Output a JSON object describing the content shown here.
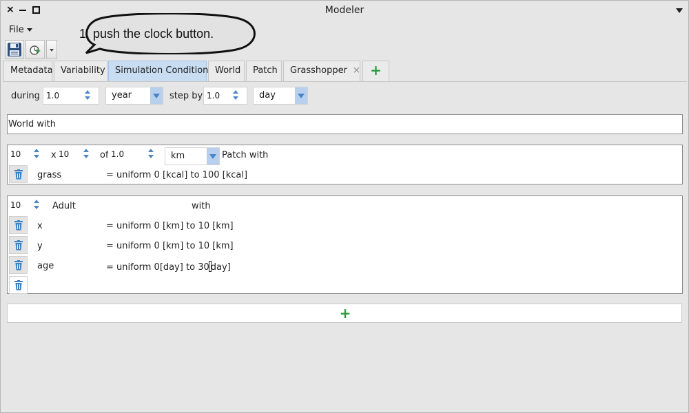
{
  "window": {
    "title": "Modeler",
    "close": "×"
  },
  "menu": {
    "file": "File"
  },
  "callout": {
    "text": "1. push the clock button."
  },
  "tabs": [
    {
      "label": "Metadata"
    },
    {
      "label": "Variability"
    },
    {
      "label": "Simulation Conditions"
    },
    {
      "label": "World"
    },
    {
      "label": "Patch"
    },
    {
      "label": "Grasshopper",
      "close": "×"
    }
  ],
  "tab_add": "+",
  "sim": {
    "during_label": "during",
    "during_value": "1.0",
    "during_unit": "year",
    "step_label": "step by",
    "step_value": "1.0",
    "step_unit": "day"
  },
  "world_panel": {
    "label": "World with"
  },
  "patch_panel": {
    "cols": "10",
    "x_label": "x",
    "rows": "10",
    "of_label": "of",
    "size": "1.0",
    "unit": "km",
    "with_label": "Patch with",
    "rows_list": [
      {
        "name": "grass",
        "expr": "= uniform 0 [kcal] to 100 [kcal]"
      }
    ]
  },
  "agent_panel": {
    "count": "10",
    "species": "Adult",
    "with_label": "with",
    "rows_list": [
      {
        "name": "x",
        "expr": "= uniform 0 [km] to 10 [km]"
      },
      {
        "name": "y",
        "expr": "= uniform 0 [km] to 10 [km]"
      },
      {
        "name": "age",
        "expr_pre": "= uniform 0[day] to 30",
        "expr_post": "day]"
      }
    ]
  },
  "add_bar": "+",
  "colors": {
    "accent_tab": "#c8dcf2",
    "add_green": "#2e9a3e",
    "spinner_blue": "#4a86c6"
  }
}
